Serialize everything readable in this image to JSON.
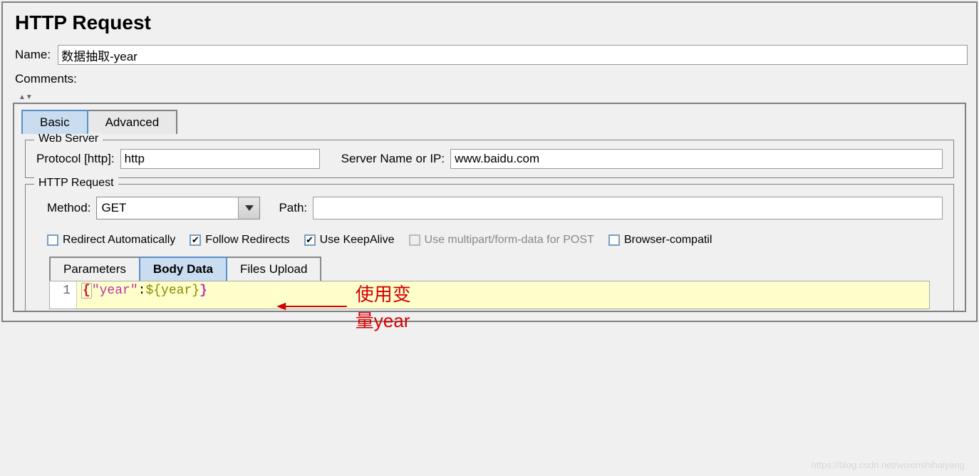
{
  "title": "HTTP Request",
  "name_field": {
    "label": "Name:",
    "value": "数据抽取-year"
  },
  "comments_field": {
    "label": "Comments:",
    "value": ""
  },
  "tabs": {
    "basic": "Basic",
    "advanced": "Advanced"
  },
  "web_server": {
    "legend": "Web Server",
    "protocol_label": "Protocol [http]:",
    "protocol_value": "http",
    "server_label": "Server Name or IP:",
    "server_value": "www.baidu.com"
  },
  "http_request": {
    "legend": "HTTP Request",
    "method_label": "Method:",
    "method_value": "GET",
    "path_label": "Path:",
    "path_value": ""
  },
  "checkboxes": {
    "redirect_auto": "Redirect Automatically",
    "follow_redirects": "Follow Redirects",
    "keepalive": "Use KeepAlive",
    "multipart": "Use multipart/form-data for POST",
    "browser_compat": "Browser-compatil"
  },
  "sub_tabs": {
    "parameters": "Parameters",
    "body_data": "Body Data",
    "files_upload": "Files Upload"
  },
  "code": {
    "line_number": "1",
    "brace_open": "{",
    "key": "\"year\"",
    "colon": ":",
    "var_open": "${",
    "var_name": "year",
    "var_close": "}",
    "brace_close": "}"
  },
  "annotation": "使用变量year",
  "watermark": "https://blog.csdn.net/woxinshihaiyang"
}
